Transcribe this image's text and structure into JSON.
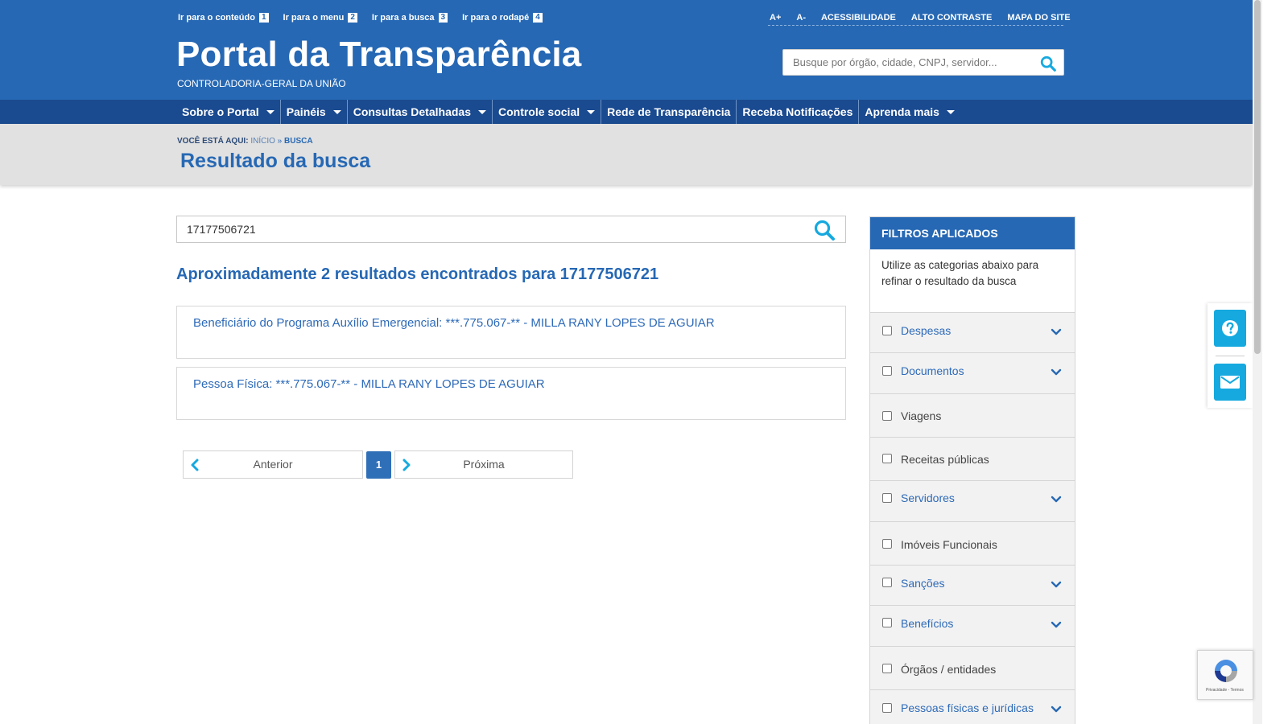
{
  "header": {
    "skip_links": [
      {
        "label": "Ir para o conteúdo",
        "key": "1"
      },
      {
        "label": "Ir para o menu",
        "key": "2"
      },
      {
        "label": "Ir para a busca",
        "key": "3"
      },
      {
        "label": "Ir para o rodapé",
        "key": "4"
      }
    ],
    "access_links": [
      "A+",
      "A-",
      "ACESSIBILIDADE",
      "ALTO CONTRASTE",
      "MAPA DO SITE"
    ],
    "title": "Portal da Transparência",
    "subtitle": "CONTROLADORIA-GERAL DA UNIÃO",
    "search_placeholder": "Busque por órgão, cidade, CNPJ, servidor..."
  },
  "nav": {
    "items": [
      {
        "label": "Sobre o Portal",
        "dropdown": true
      },
      {
        "label": "Painéis",
        "dropdown": true
      },
      {
        "label": "Consultas Detalhadas",
        "dropdown": true
      },
      {
        "label": "Controle social",
        "dropdown": true
      },
      {
        "label": "Rede de Transparência",
        "dropdown": false
      },
      {
        "label": "Receba Notificações",
        "dropdown": false
      },
      {
        "label": "Aprenda mais",
        "dropdown": true
      }
    ]
  },
  "breadcrumb": {
    "prefix": "VOCÊ ESTÁ AQUI:",
    "home": "INÍCIO",
    "separator": "»",
    "current": "BUSCA"
  },
  "page": {
    "title": "Resultado da busca"
  },
  "search": {
    "value": "17177506721"
  },
  "results": {
    "heading": "Aproximadamente 2 resultados encontrados para 17177506721",
    "items": [
      "Beneficiário do Programa Auxílio Emergencial: ***.775.067-** - MILLA RANY LOPES DE AGUIAR",
      "Pessoa Física: ***.775.067-** - MILLA RANY LOPES DE AGUIAR"
    ]
  },
  "pagination": {
    "prev_label": "Anterior",
    "current_page": "1",
    "next_label": "Próxima"
  },
  "filters": {
    "title": "FILTROS APLICADOS",
    "intro": "Utilize as categorias abaixo para refinar o resultado da busca",
    "items": [
      {
        "label": "Despesas",
        "expandable": true
      },
      {
        "label": "Documentos",
        "expandable": true
      },
      {
        "label": "Viagens",
        "expandable": false
      },
      {
        "label": "Receitas públicas",
        "expandable": false
      },
      {
        "label": "Servidores",
        "expandable": true
      },
      {
        "label": "Imóveis Funcionais",
        "expandable": false
      },
      {
        "label": "Sanções",
        "expandable": true
      },
      {
        "label": "Benefícios",
        "expandable": true
      },
      {
        "label": "Órgãos / entidades",
        "expandable": false
      },
      {
        "label": "Pessoas físicas e jurídicas",
        "expandable": true
      }
    ]
  },
  "side_widgets": {
    "icons": [
      "help-icon",
      "mail-icon"
    ]
  },
  "recaptcha": {
    "text": "Privacidade - Termos"
  },
  "colors": {
    "header_blue": "#2668b4",
    "nav_blue": "#1a4a90",
    "accent_cyan": "#15a9df",
    "band_gray": "#e1e1e1"
  }
}
